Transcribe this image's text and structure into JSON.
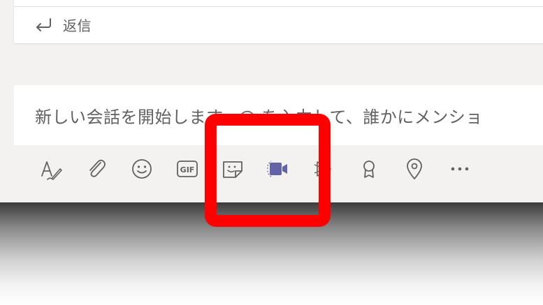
{
  "reply": {
    "label": "返信",
    "icon": "reply-arrow-icon"
  },
  "compose": {
    "placeholder": "新しい会話を開始します。@ を入力して、誰かにメンショ"
  },
  "toolbar": {
    "items": [
      {
        "name": "format",
        "icon": "format-text-icon",
        "tooltip": ""
      },
      {
        "name": "attach",
        "icon": "paperclip-icon"
      },
      {
        "name": "emoji",
        "icon": "smiley-icon"
      },
      {
        "name": "gif",
        "icon": "gif-icon",
        "text": "GIF"
      },
      {
        "name": "sticker",
        "icon": "sticker-icon"
      },
      {
        "name": "meet-now",
        "icon": "video-camera-icon",
        "active": true
      },
      {
        "name": "stream",
        "icon": "stream-play-icon"
      },
      {
        "name": "praise",
        "icon": "award-ribbon-icon"
      },
      {
        "name": "location",
        "icon": "map-pin-icon"
      },
      {
        "name": "more",
        "icon": "more-dots-icon"
      }
    ]
  },
  "colors": {
    "icon": "#616161",
    "accent": "#6264a7",
    "highlight": "#ff0000",
    "background": "#f3f2f1",
    "surface": "#ffffff"
  }
}
